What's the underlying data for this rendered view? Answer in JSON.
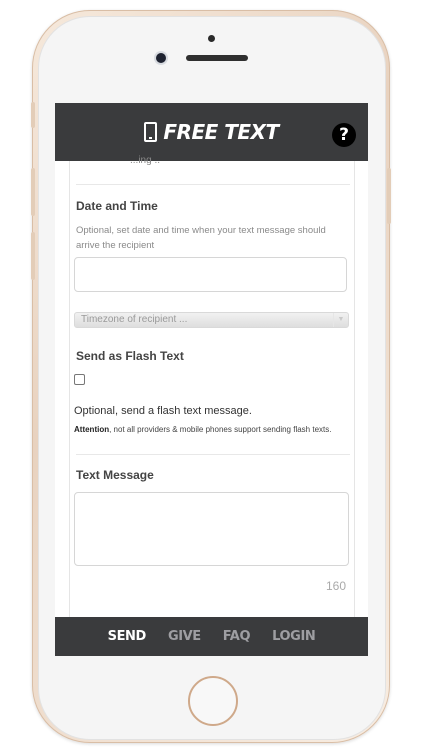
{
  "app": {
    "brand_title": "FREE TEXT",
    "help_label": "?"
  },
  "form": {
    "cut_off_text": "...ing ..",
    "date_time": {
      "label": "Date and Time",
      "hint": "Optional, set date and time when your text message should arrive the recipient",
      "value": ""
    },
    "timezone": {
      "selected": "Timezone of recipient ..."
    },
    "flash": {
      "label": "Send as Flash Text",
      "checked": false,
      "description": "Optional, send a flash text message.",
      "attention_bold": "Attention",
      "attention_rest": ", not all providers & mobile phones support sending flash texts."
    },
    "message": {
      "label": "Text Message",
      "value": "",
      "counter": "160"
    }
  },
  "nav": {
    "items": [
      "SEND",
      "GIVE",
      "FAQ",
      "LOGIN"
    ],
    "active": "SEND"
  },
  "colors": {
    "bar": "#3a3b3d",
    "nav_active": "#ffffff",
    "nav_inactive": "#9e9ea2",
    "phone_frame": "#f3e3d3"
  }
}
